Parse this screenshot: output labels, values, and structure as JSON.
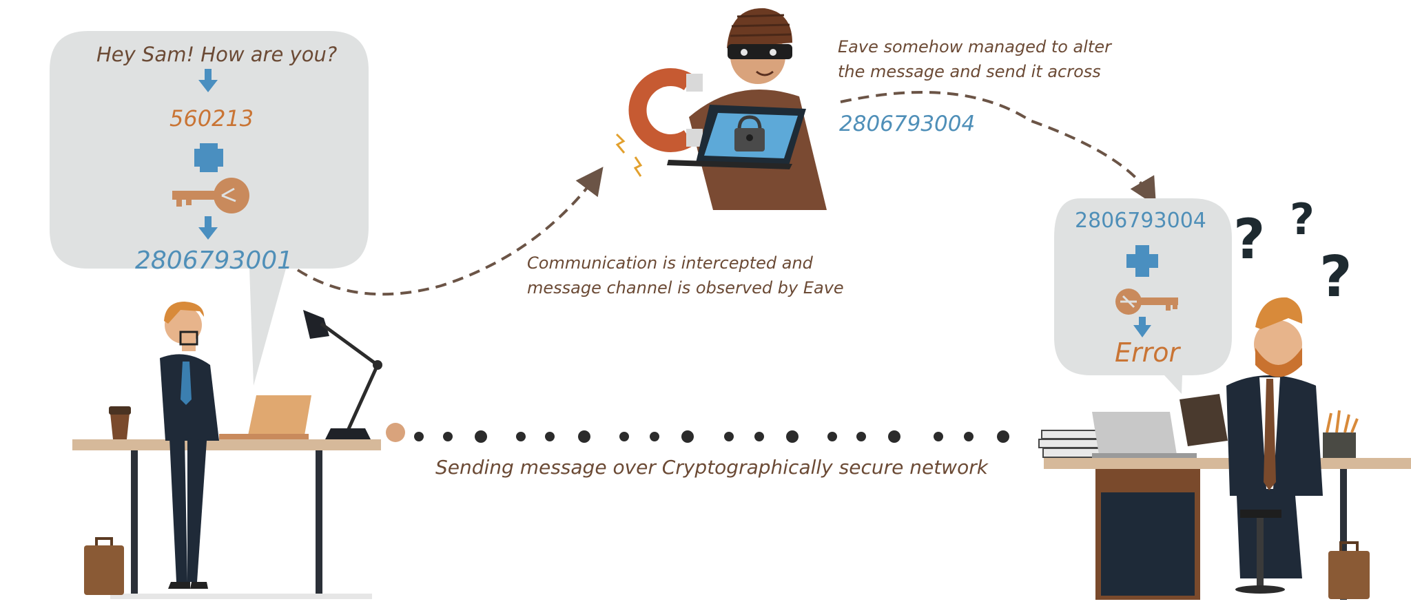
{
  "sender_bubble": {
    "message": "Hey Sam! How are you?",
    "encoded": "560213",
    "encrypted": "2806793001"
  },
  "attacker": {
    "note": [
      "Eave somehow managed to alter",
      "the message and send it across"
    ],
    "altered": "2806793004"
  },
  "intercept_note": [
    "Communication is intercepted and",
    "message channel is observed by Eave"
  ],
  "network_caption": "Sending message over Cryptographically secure network",
  "receiver_bubble": {
    "received": "2806793004",
    "result": "Error"
  },
  "colors": {
    "bubble": "#dfe1e1",
    "arrow_blue": "#4a8fc0",
    "number_blue": "#4f8fb8",
    "key_orange": "#c98a5c",
    "text_brown": "#6b4a35",
    "suit": "#1f2a38",
    "dots": "#2b2b2b"
  }
}
